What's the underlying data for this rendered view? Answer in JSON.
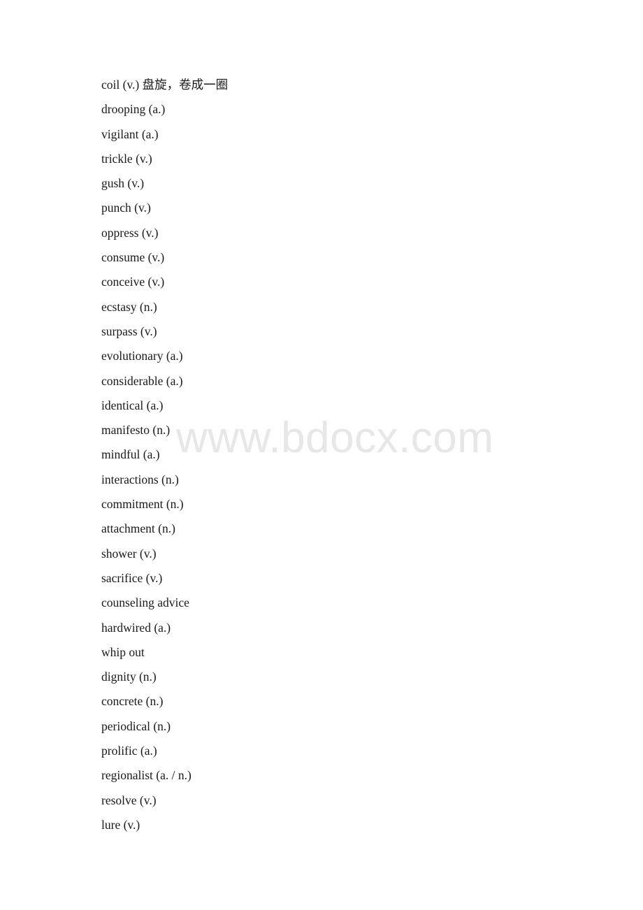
{
  "document": {
    "background_color": "#ffffff",
    "text_color": "#1a1a1a"
  },
  "watermark": {
    "text": "www.bdocx.com",
    "color": "#e7e7e7"
  },
  "vocabulary": {
    "entries": [
      {
        "text": "coil (v.) 盘旋，卷成一圈"
      },
      {
        "text": "drooping (a.)"
      },
      {
        "text": "vigilant (a.)"
      },
      {
        "text": "trickle (v.)"
      },
      {
        "text": "gush (v.)"
      },
      {
        "text": "punch (v.)"
      },
      {
        "text": "oppress (v.)"
      },
      {
        "text": "consume (v.)"
      },
      {
        "text": "conceive (v.)"
      },
      {
        "text": "ecstasy (n.)"
      },
      {
        "text": "surpass (v.)"
      },
      {
        "text": "evolutionary (a.)"
      },
      {
        "text": "considerable (a.)"
      },
      {
        "text": "identical (a.)"
      },
      {
        "text": "manifesto (n.)"
      },
      {
        "text": "mindful (a.)"
      },
      {
        "text": "interactions (n.)"
      },
      {
        "text": "commitment (n.)"
      },
      {
        "text": "attachment (n.)"
      },
      {
        "text": "shower (v.)"
      },
      {
        "text": "sacrifice (v.)"
      },
      {
        "text": "counseling advice"
      },
      {
        "text": "hardwired (a.)"
      },
      {
        "text": "whip out"
      },
      {
        "text": "dignity (n.)"
      },
      {
        "text": "concrete (n.)"
      },
      {
        "text": "periodical (n.)"
      },
      {
        "text": "prolific (a.)"
      },
      {
        "text": "regionalist (a. / n.)"
      },
      {
        "text": "resolve (v.)"
      },
      {
        "text": "lure (v.)"
      }
    ]
  }
}
